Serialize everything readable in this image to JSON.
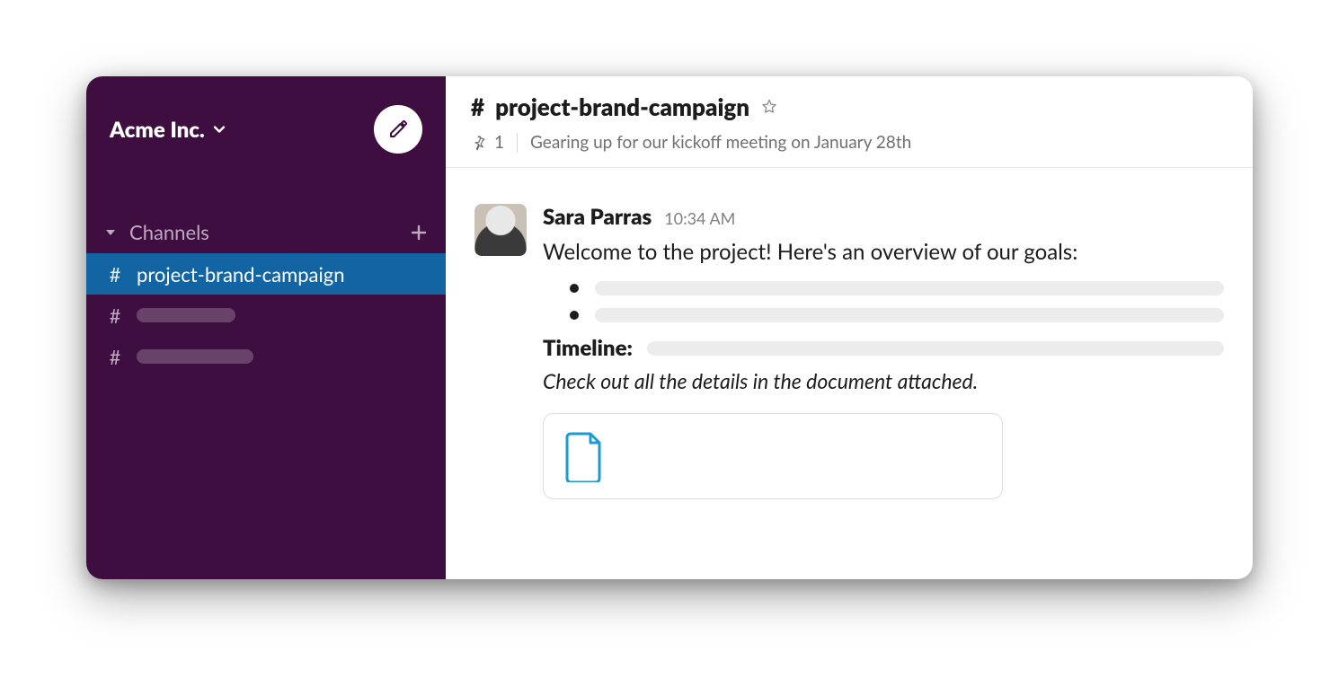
{
  "workspace": {
    "name": "Acme Inc."
  },
  "sidebar": {
    "section_label": "Channels",
    "items": [
      {
        "name": "project-brand-campaign",
        "active": true
      }
    ]
  },
  "channel": {
    "name": "project-brand-campaign",
    "pinned_count": "1",
    "topic": "Gearing up for our kickoff meeting on January 28th"
  },
  "message": {
    "author": "Sara Parras",
    "time": "10:34 AM",
    "intro": "Welcome to the project! Here's an overview of our goals:",
    "timeline_label": "Timeline:",
    "note": "Check out all the details in the document attached."
  }
}
